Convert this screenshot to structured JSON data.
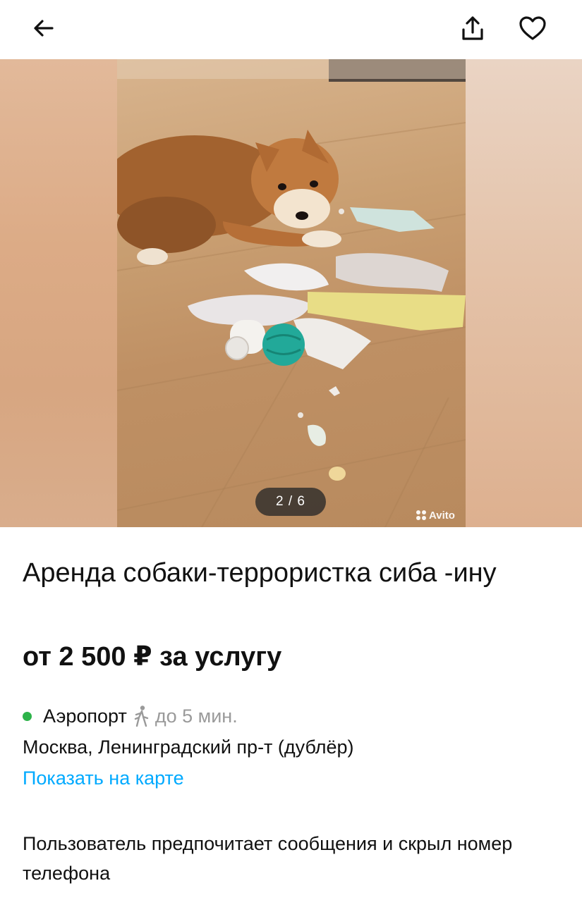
{
  "header": {
    "back_icon": "arrow-left-icon",
    "share_icon": "share-icon",
    "favorite_icon": "heart-icon"
  },
  "gallery": {
    "counter": "2 / 6",
    "watermark": "Avito",
    "current_index": 2,
    "total": 6
  },
  "listing": {
    "title": "Аренда собаки-террористка сиба -ину",
    "price": "от 2 500 ₽ за услугу"
  },
  "location": {
    "metro_station": "Аэропорт",
    "metro_line_color": "#2db34a",
    "walk_time": "до 5 мин.",
    "address": "Москва, Ленинградский пр-т (дублёр)",
    "map_link": "Показать на карте"
  },
  "contact": {
    "note": "Пользователь предпочитает сообщения и скрыл номер телефона"
  },
  "colors": {
    "link": "#00aaff",
    "text": "#111111",
    "muted": "#9a9a9a"
  }
}
